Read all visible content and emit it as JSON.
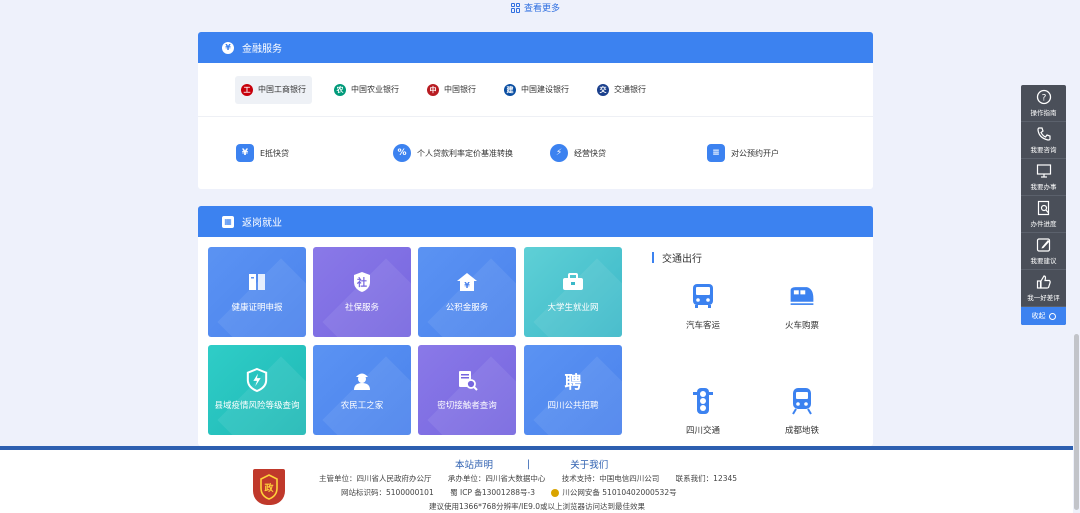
{
  "top": {
    "view_more": "查看更多"
  },
  "finance": {
    "title": "金融服务",
    "banks": [
      {
        "name": "中国工商银行",
        "color": "#c7000b",
        "active": true
      },
      {
        "name": "中国农业银行",
        "color": "#009a7a"
      },
      {
        "name": "中国银行",
        "color": "#b81c22"
      },
      {
        "name": "中国建设银行",
        "color": "#0a4ea2"
      },
      {
        "name": "交通银行",
        "color": "#1a3f8c"
      }
    ],
    "services": [
      {
        "label": "E抵快贷"
      },
      {
        "label": "个人贷款利率定价基准转换"
      },
      {
        "label": "经营快贷"
      },
      {
        "label": "对公预约开户"
      }
    ]
  },
  "employment": {
    "title": "返岗就业",
    "tiles": [
      {
        "label": "健康证明申报",
        "icon": "book-icon"
      },
      {
        "label": "社保服务",
        "icon": "shield-she-icon",
        "glyph": "社"
      },
      {
        "label": "公积金服务",
        "icon": "house-yen-icon",
        "glyph": "¥"
      },
      {
        "label": "大学生就业网",
        "icon": "briefcase-icon"
      },
      {
        "label": "县域疫情风险等级查询",
        "icon": "shield-lightning-icon"
      },
      {
        "label": "农民工之家",
        "icon": "worker-icon"
      },
      {
        "label": "密切接触者查询",
        "icon": "document-search-icon"
      },
      {
        "label": "四川公共招聘",
        "icon": "recruit-icon",
        "glyph": "聘"
      }
    ],
    "traffic": {
      "title": "交通出行",
      "items": [
        {
          "label": "汽车客运",
          "icon": "bus-icon"
        },
        {
          "label": "火车购票",
          "icon": "train-icon"
        },
        {
          "label": "四川交通",
          "icon": "traffic-light-icon"
        },
        {
          "label": "成都地铁",
          "icon": "metro-icon"
        }
      ]
    }
  },
  "footer": {
    "links": {
      "statement": "本站声明",
      "separator": "|",
      "about": "关于我们"
    },
    "row1": {
      "host": "主管单位：四川省人民政府办公厅",
      "organizer": "承办单位：四川省大数据中心",
      "support": "技术支持：中国电信四川公司",
      "contact": "联系我们：12345"
    },
    "row2": {
      "site_id": "网站标识码：5100000101",
      "icp": "蜀 ICP 备13001288号-3",
      "police": "川公网安备 51010402000532号"
    },
    "row3": "建议使用1366*768分辨率/IE9.0或以上浏览器访问达到最佳效果",
    "logo_glyph": "党政机关"
  },
  "sidebar": {
    "items": [
      {
        "label": "操作指南",
        "icon": "question-icon"
      },
      {
        "label": "我要咨询",
        "icon": "phone-icon"
      },
      {
        "label": "我要办事",
        "icon": "monitor-icon"
      },
      {
        "label": "办件进度",
        "icon": "document-search-icon"
      },
      {
        "label": "我要建议",
        "icon": "edit-icon"
      },
      {
        "label": "我一好差评",
        "icon": "thumbs-up-icon"
      }
    ],
    "collapse": "收起"
  },
  "colors": {
    "accent": "#3c82f0",
    "highlight": "#ffd23a",
    "footer_line": "#2d5fb0"
  }
}
